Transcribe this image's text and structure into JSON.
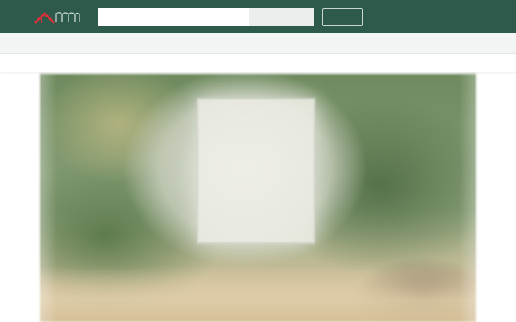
{
  "header": {
    "logo_icon": "house-roofline-logo",
    "search": {
      "placeholder": "",
      "button_label": ""
    },
    "button_label": "",
    "links": [
      "",
      ""
    ]
  },
  "subnav": {
    "items": [
      "",
      "",
      "",
      "",
      ""
    ],
    "right_link": ""
  },
  "catnav": {
    "items": [
      "",
      "",
      "",
      "",
      "",
      "",
      "",
      ""
    ]
  },
  "hero": {
    "image": "blurred-living-room-photo"
  },
  "colors": {
    "header_bg": "#2e5a4c",
    "accent": "#c7262b",
    "subnav_bg": "#f3f4f4"
  }
}
